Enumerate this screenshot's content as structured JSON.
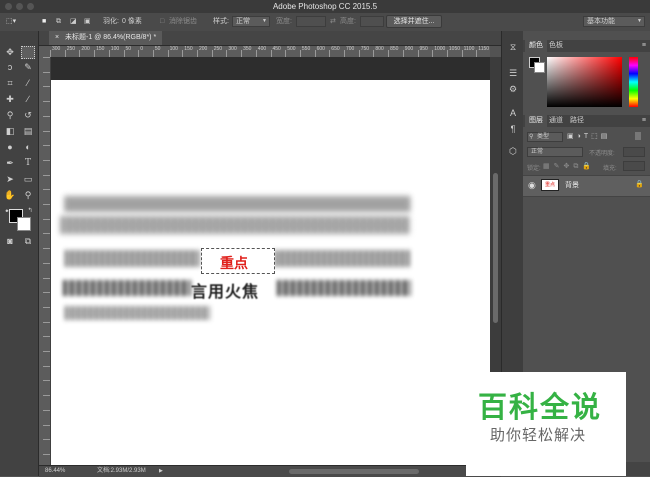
{
  "window": {
    "title": "Adobe Photoshop CC 2015.5"
  },
  "options_bar": {
    "feather_label": "羽化:",
    "feather_value": "0 像素",
    "antialias_label": "消除锯齿",
    "style_label": "样式:",
    "style_value": "正常",
    "width_label": "宽度:",
    "height_label": "高度:",
    "select_mask_button": "选择并遮住...",
    "workspace_value": "基本功能"
  },
  "document_tab": {
    "label": "未标题-1 @ 86.4%(RGB/8*) *"
  },
  "ruler_ticks": [
    "300",
    "250",
    "200",
    "150",
    "100",
    "50",
    "0",
    "50",
    "100",
    "150",
    "200",
    "250",
    "300",
    "350",
    "400",
    "450",
    "500",
    "550",
    "600",
    "650",
    "700",
    "750",
    "800",
    "850",
    "900",
    "950",
    "1000",
    "1050",
    "1100",
    "1150"
  ],
  "canvas_art": {
    "highlight_text": "重点",
    "blur_text": "言用火焦",
    "accent_color": "#e0201b"
  },
  "status_bar": {
    "zoom": "86.44%",
    "doc_info": "文档:2.93M/2.93M"
  },
  "color_panel": {
    "tabs": [
      "颜色",
      "色板"
    ]
  },
  "layers_panel": {
    "tabs": [
      "图层",
      "通道",
      "路径"
    ],
    "kind_filter": "类型",
    "blend_mode": "正常",
    "opacity_label": "不透明度:",
    "lock_label": "锁定:",
    "fill_label": "填充:",
    "layer_name": "背景",
    "layer_thumb_text": "重点"
  },
  "watermark": {
    "title": "百科全说",
    "subtitle": "助你轻松解决"
  },
  "colors": {
    "workspace_gray": "#535353",
    "panel_gray": "#505050",
    "highlight_red": "#e0201b",
    "watermark_green": "#35b244"
  }
}
